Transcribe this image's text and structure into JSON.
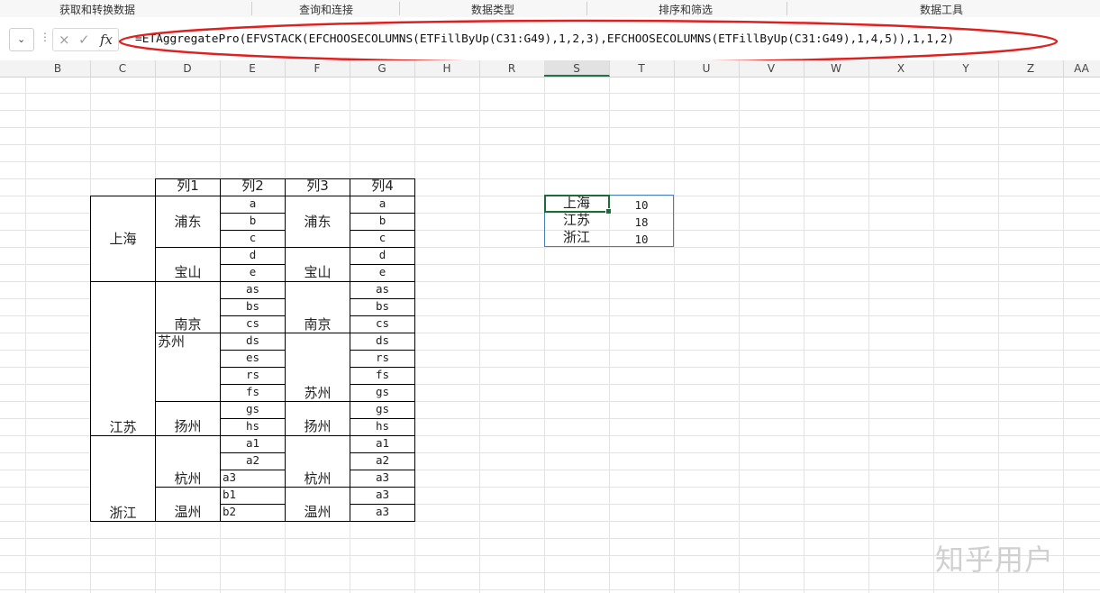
{
  "ribbon": {
    "groups": [
      "获取和转换数据",
      "查询和连接",
      "数据类型",
      "排序和筛选",
      "数据工具"
    ]
  },
  "formula_bar": {
    "cancel_icon": "×",
    "confirm_icon": "✓",
    "fx_label": "fx",
    "formula": "=ETAggregatePro(EFVSTACK(EFCHOOSECOLUMNS(ETFillByUp(C31:G49),1,2,3),EFCHOOSECOLUMNS(ETFillByUp(C31:G49),1,4,5)),1,1,2)",
    "highlight_color": "#e02020"
  },
  "columns": [
    "B",
    "C",
    "D",
    "E",
    "F",
    "G",
    "H",
    "R",
    "S",
    "T",
    "U",
    "V",
    "W",
    "X",
    "Y",
    "Z",
    "AA"
  ],
  "active_column": "S",
  "source_table": {
    "headers": [
      "列1",
      "列2",
      "列3",
      "列4"
    ],
    "provinces": [
      "上海",
      "江苏",
      "浙江"
    ],
    "cities_col2": [
      "浦东",
      "宝山",
      "南京",
      "苏州",
      "扬州",
      "杭州",
      "温州"
    ],
    "items_col2": [
      "a",
      "b",
      "c",
      "d",
      "e",
      "as",
      "bs",
      "cs",
      "ds",
      "es",
      "rs",
      "fs",
      "gs",
      "hs",
      "a1",
      "a2",
      "a3",
      "b1",
      "b2"
    ],
    "cities_col3": [
      "浦东",
      "宝山",
      "南京",
      "苏州",
      "扬州",
      "杭州",
      "温州"
    ],
    "items_col4": [
      "a",
      "b",
      "c",
      "d",
      "e",
      "as",
      "bs",
      "cs",
      "ds",
      "rs",
      "fs",
      "gs",
      "gs",
      "hs",
      "a1",
      "a2",
      "a3",
      "a3",
      "a3"
    ]
  },
  "summary": {
    "rows": [
      {
        "name": "上海",
        "value": "10"
      },
      {
        "name": "江苏",
        "value": "18"
      },
      {
        "name": "浙江",
        "value": "10"
      }
    ],
    "border_color": "#4a7ebb",
    "active_color": "#1e6b3c"
  },
  "watermark": "知乎用户"
}
